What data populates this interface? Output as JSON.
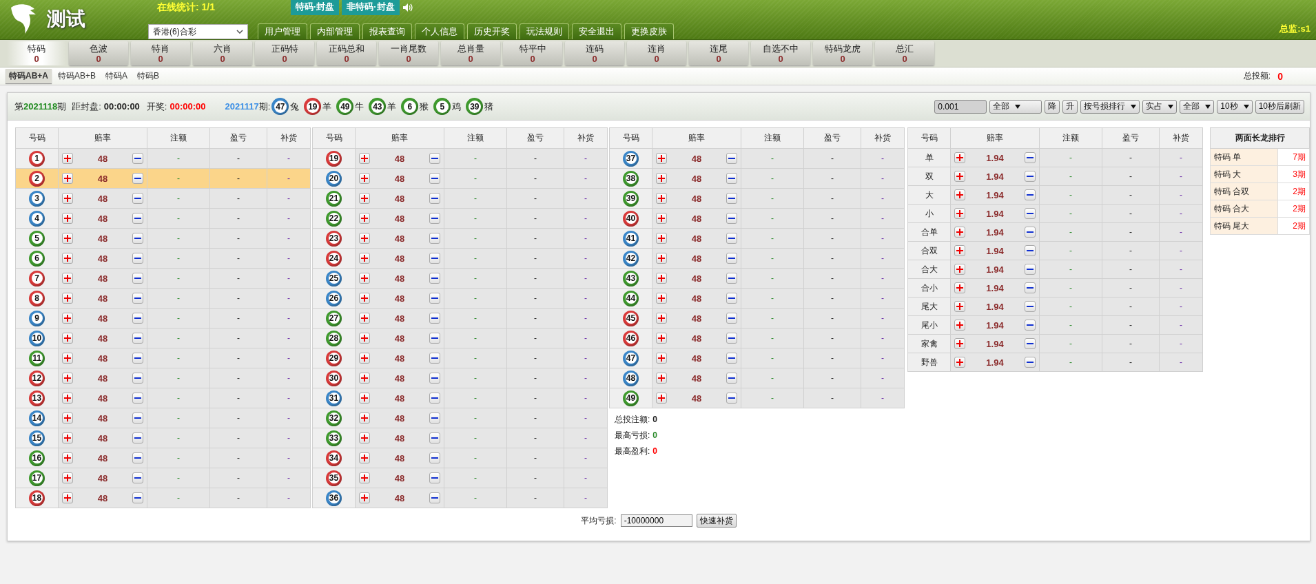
{
  "header": {
    "logo_text": "测试",
    "online": "在线统计: 1/1",
    "status_badges": [
      "特码·封盘",
      "非特码·封盘"
    ],
    "lottery_select": "香港(6)合彩",
    "nav": [
      "用户管理",
      "内部管理",
      "报表查询",
      "个人信息",
      "历史开奖",
      "玩法规则",
      "安全退出",
      "更换皮肤"
    ],
    "user": "总监:s1"
  },
  "category_tabs": [
    {
      "label": "特码",
      "count": "0",
      "selected": true
    },
    {
      "label": "色波",
      "count": "0",
      "selected": false
    },
    {
      "label": "特肖",
      "count": "0",
      "selected": false
    },
    {
      "label": "六肖",
      "count": "0",
      "selected": false
    },
    {
      "label": "正码特",
      "count": "0",
      "selected": false
    },
    {
      "label": "正码总和",
      "count": "0",
      "selected": false
    },
    {
      "label": "一肖尾数",
      "count": "0",
      "selected": false
    },
    {
      "label": "总肖量",
      "count": "0",
      "selected": false
    },
    {
      "label": "特平中",
      "count": "0",
      "selected": false
    },
    {
      "label": "连码",
      "count": "0",
      "selected": false
    },
    {
      "label": "连肖",
      "count": "0",
      "selected": false
    },
    {
      "label": "连尾",
      "count": "0",
      "selected": false
    },
    {
      "label": "自选不中",
      "count": "0",
      "selected": false
    },
    {
      "label": "特码龙虎",
      "count": "0",
      "selected": false
    },
    {
      "label": "总汇",
      "count": "0",
      "selected": false
    }
  ],
  "sub_tabs": [
    {
      "label": "特码AB+A",
      "selected": true
    },
    {
      "label": "特码AB+B",
      "selected": false
    },
    {
      "label": "特码A",
      "selected": false
    },
    {
      "label": "特码B",
      "selected": false
    }
  ],
  "total_bet": {
    "label": "总投额:",
    "value": "0"
  },
  "draw_info": {
    "prefix": "第",
    "period": "2021118",
    "suffix": "期",
    "close_label": "距封盘:",
    "close_time": "00:00:00",
    "draw_label": "开奖:",
    "draw_time": "00:00:00",
    "last_period": "2021117",
    "last_suffix": "期:",
    "last_result": [
      {
        "number": "47",
        "color": "#3a86c8",
        "zodiac": "兔"
      },
      {
        "number": "19",
        "color": "#d83a3a",
        "zodiac": "羊"
      },
      {
        "number": "49",
        "color": "#3f9a2e",
        "zodiac": "牛"
      },
      {
        "number": "43",
        "color": "#3f9a2e",
        "zodiac": "羊"
      },
      {
        "number": "6",
        "color": "#3f9a2e",
        "zodiac": "猴"
      },
      {
        "number": "5",
        "color": "#3f9a2e",
        "zodiac": "鸡"
      },
      {
        "number": "39",
        "color": "#3f9a2e",
        "zodiac": "猪"
      }
    ]
  },
  "controls": [
    {
      "kind": "input",
      "value": "0.001"
    },
    {
      "kind": "select",
      "label": "全部"
    },
    {
      "kind": "button",
      "label": "降"
    },
    {
      "kind": "button",
      "label": "升"
    },
    {
      "kind": "select",
      "label": "按号损排行"
    },
    {
      "kind": "select",
      "label": "实占"
    },
    {
      "kind": "select",
      "label": "全部"
    },
    {
      "kind": "select",
      "label": "10秒"
    },
    {
      "kind": "button",
      "label": "10秒后刷新"
    }
  ],
  "number_tables": [
    {
      "columns": [
        "号码",
        "赔率",
        "注额",
        "盈亏",
        "补货"
      ],
      "rows": [
        {
          "number": "1",
          "color": "#d83a3a",
          "odds": "48",
          "bet": "-",
          "profit": "-",
          "cover": "-",
          "selected": false
        },
        {
          "number": "2",
          "color": "#d83a3a",
          "odds": "48",
          "bet": "-",
          "profit": "-",
          "cover": "-",
          "selected": true
        },
        {
          "number": "3",
          "color": "#3a86c8",
          "odds": "48",
          "bet": "-",
          "profit": "-",
          "cover": "-",
          "selected": false
        },
        {
          "number": "4",
          "color": "#3a86c8",
          "odds": "48",
          "bet": "-",
          "profit": "-",
          "cover": "-",
          "selected": false
        },
        {
          "number": "5",
          "color": "#3f9a2e",
          "odds": "48",
          "bet": "-",
          "profit": "-",
          "cover": "-",
          "selected": false
        },
        {
          "number": "6",
          "color": "#3f9a2e",
          "odds": "48",
          "bet": "-",
          "profit": "-",
          "cover": "-",
          "selected": false
        },
        {
          "number": "7",
          "color": "#d83a3a",
          "odds": "48",
          "bet": "-",
          "profit": "-",
          "cover": "-",
          "selected": false
        },
        {
          "number": "8",
          "color": "#d83a3a",
          "odds": "48",
          "bet": "-",
          "profit": "-",
          "cover": "-",
          "selected": false
        },
        {
          "number": "9",
          "color": "#3a86c8",
          "odds": "48",
          "bet": "-",
          "profit": "-",
          "cover": "-",
          "selected": false
        },
        {
          "number": "10",
          "color": "#3a86c8",
          "odds": "48",
          "bet": "-",
          "profit": "-",
          "cover": "-",
          "selected": false
        },
        {
          "number": "11",
          "color": "#3f9a2e",
          "odds": "48",
          "bet": "-",
          "profit": "-",
          "cover": "-",
          "selected": false
        },
        {
          "number": "12",
          "color": "#d83a3a",
          "odds": "48",
          "bet": "-",
          "profit": "-",
          "cover": "-",
          "selected": false
        },
        {
          "number": "13",
          "color": "#d83a3a",
          "odds": "48",
          "bet": "-",
          "profit": "-",
          "cover": "-",
          "selected": false
        },
        {
          "number": "14",
          "color": "#3a86c8",
          "odds": "48",
          "bet": "-",
          "profit": "-",
          "cover": "-",
          "selected": false
        },
        {
          "number": "15",
          "color": "#3a86c8",
          "odds": "48",
          "bet": "-",
          "profit": "-",
          "cover": "-",
          "selected": false
        },
        {
          "number": "16",
          "color": "#3f9a2e",
          "odds": "48",
          "bet": "-",
          "profit": "-",
          "cover": "-",
          "selected": false
        },
        {
          "number": "17",
          "color": "#3f9a2e",
          "odds": "48",
          "bet": "-",
          "profit": "-",
          "cover": "-",
          "selected": false
        },
        {
          "number": "18",
          "color": "#d83a3a",
          "odds": "48",
          "bet": "-",
          "profit": "-",
          "cover": "-",
          "selected": false
        }
      ]
    },
    {
      "columns": [
        "号码",
        "赔率",
        "注额",
        "盈亏",
        "补货"
      ],
      "rows": [
        {
          "number": "19",
          "color": "#d83a3a",
          "odds": "48",
          "bet": "-",
          "profit": "-",
          "cover": "-",
          "selected": false
        },
        {
          "number": "20",
          "color": "#3a86c8",
          "odds": "48",
          "bet": "-",
          "profit": "-",
          "cover": "-",
          "selected": false
        },
        {
          "number": "21",
          "color": "#3f9a2e",
          "odds": "48",
          "bet": "-",
          "profit": "-",
          "cover": "-",
          "selected": false
        },
        {
          "number": "22",
          "color": "#3f9a2e",
          "odds": "48",
          "bet": "-",
          "profit": "-",
          "cover": "-",
          "selected": false
        },
        {
          "number": "23",
          "color": "#d83a3a",
          "odds": "48",
          "bet": "-",
          "profit": "-",
          "cover": "-",
          "selected": false
        },
        {
          "number": "24",
          "color": "#d83a3a",
          "odds": "48",
          "bet": "-",
          "profit": "-",
          "cover": "-",
          "selected": false
        },
        {
          "number": "25",
          "color": "#3a86c8",
          "odds": "48",
          "bet": "-",
          "profit": "-",
          "cover": "-",
          "selected": false
        },
        {
          "number": "26",
          "color": "#3a86c8",
          "odds": "48",
          "bet": "-",
          "profit": "-",
          "cover": "-",
          "selected": false
        },
        {
          "number": "27",
          "color": "#3f9a2e",
          "odds": "48",
          "bet": "-",
          "profit": "-",
          "cover": "-",
          "selected": false
        },
        {
          "number": "28",
          "color": "#3f9a2e",
          "odds": "48",
          "bet": "-",
          "profit": "-",
          "cover": "-",
          "selected": false
        },
        {
          "number": "29",
          "color": "#d83a3a",
          "odds": "48",
          "bet": "-",
          "profit": "-",
          "cover": "-",
          "selected": false
        },
        {
          "number": "30",
          "color": "#d83a3a",
          "odds": "48",
          "bet": "-",
          "profit": "-",
          "cover": "-",
          "selected": false
        },
        {
          "number": "31",
          "color": "#3a86c8",
          "odds": "48",
          "bet": "-",
          "profit": "-",
          "cover": "-",
          "selected": false
        },
        {
          "number": "32",
          "color": "#3f9a2e",
          "odds": "48",
          "bet": "-",
          "profit": "-",
          "cover": "-",
          "selected": false
        },
        {
          "number": "33",
          "color": "#3f9a2e",
          "odds": "48",
          "bet": "-",
          "profit": "-",
          "cover": "-",
          "selected": false
        },
        {
          "number": "34",
          "color": "#d83a3a",
          "odds": "48",
          "bet": "-",
          "profit": "-",
          "cover": "-",
          "selected": false
        },
        {
          "number": "35",
          "color": "#d83a3a",
          "odds": "48",
          "bet": "-",
          "profit": "-",
          "cover": "-",
          "selected": false
        },
        {
          "number": "36",
          "color": "#3a86c8",
          "odds": "48",
          "bet": "-",
          "profit": "-",
          "cover": "-",
          "selected": false
        }
      ]
    },
    {
      "columns": [
        "号码",
        "赔率",
        "注额",
        "盈亏",
        "补货"
      ],
      "rows": [
        {
          "number": "37",
          "color": "#3a86c8",
          "odds": "48",
          "bet": "-",
          "profit": "-",
          "cover": "-",
          "selected": false
        },
        {
          "number": "38",
          "color": "#3f9a2e",
          "odds": "48",
          "bet": "-",
          "profit": "-",
          "cover": "-",
          "selected": false
        },
        {
          "number": "39",
          "color": "#3f9a2e",
          "odds": "48",
          "bet": "-",
          "profit": "-",
          "cover": "-",
          "selected": false
        },
        {
          "number": "40",
          "color": "#d83a3a",
          "odds": "48",
          "bet": "-",
          "profit": "-",
          "cover": "-",
          "selected": false
        },
        {
          "number": "41",
          "color": "#3a86c8",
          "odds": "48",
          "bet": "-",
          "profit": "-",
          "cover": "-",
          "selected": false
        },
        {
          "number": "42",
          "color": "#3a86c8",
          "odds": "48",
          "bet": "-",
          "profit": "-",
          "cover": "-",
          "selected": false
        },
        {
          "number": "43",
          "color": "#3f9a2e",
          "odds": "48",
          "bet": "-",
          "profit": "-",
          "cover": "-",
          "selected": false
        },
        {
          "number": "44",
          "color": "#3f9a2e",
          "odds": "48",
          "bet": "-",
          "profit": "-",
          "cover": "-",
          "selected": false
        },
        {
          "number": "45",
          "color": "#d83a3a",
          "odds": "48",
          "bet": "-",
          "profit": "-",
          "cover": "-",
          "selected": false
        },
        {
          "number": "46",
          "color": "#d83a3a",
          "odds": "48",
          "bet": "-",
          "profit": "-",
          "cover": "-",
          "selected": false
        },
        {
          "number": "47",
          "color": "#3a86c8",
          "odds": "48",
          "bet": "-",
          "profit": "-",
          "cover": "-",
          "selected": false
        },
        {
          "number": "48",
          "color": "#3a86c8",
          "odds": "48",
          "bet": "-",
          "profit": "-",
          "cover": "-",
          "selected": false
        },
        {
          "number": "49",
          "color": "#3f9a2e",
          "odds": "48",
          "bet": "-",
          "profit": "-",
          "cover": "-",
          "selected": false
        }
      ]
    }
  ],
  "summary": [
    {
      "kind": "total",
      "label": "总投注额:",
      "value": "0"
    },
    {
      "kind": "loss",
      "label": "最高亏损:",
      "value": "0"
    },
    {
      "kind": "profit",
      "label": "最高盈利:",
      "value": "0"
    }
  ],
  "attribute_table": {
    "columns": [
      "号码",
      "赔率",
      "注额",
      "盈亏",
      "补货"
    ],
    "rows": [
      {
        "name": "单",
        "odds": "1.94",
        "bet": "-",
        "profit": "-",
        "cover": "-"
      },
      {
        "name": "双",
        "odds": "1.94",
        "bet": "-",
        "profit": "-",
        "cover": "-"
      },
      {
        "name": "大",
        "odds": "1.94",
        "bet": "-",
        "profit": "-",
        "cover": "-"
      },
      {
        "name": "小",
        "odds": "1.94",
        "bet": "-",
        "profit": "-",
        "cover": "-"
      },
      {
        "name": "合单",
        "odds": "1.94",
        "bet": "-",
        "profit": "-",
        "cover": "-"
      },
      {
        "name": "合双",
        "odds": "1.94",
        "bet": "-",
        "profit": "-",
        "cover": "-"
      },
      {
        "name": "合大",
        "odds": "1.94",
        "bet": "-",
        "profit": "-",
        "cover": "-"
      },
      {
        "name": "合小",
        "odds": "1.94",
        "bet": "-",
        "profit": "-",
        "cover": "-"
      },
      {
        "name": "尾大",
        "odds": "1.94",
        "bet": "-",
        "profit": "-",
        "cover": "-"
      },
      {
        "name": "尾小",
        "odds": "1.94",
        "bet": "-",
        "profit": "-",
        "cover": "-"
      },
      {
        "name": "家禽",
        "odds": "1.94",
        "bet": "-",
        "profit": "-",
        "cover": "-"
      },
      {
        "name": "野兽",
        "odds": "1.94",
        "bet": "-",
        "profit": "-",
        "cover": "-"
      }
    ]
  },
  "streak_ranking": {
    "title": "两面长龙排行",
    "rows": [
      {
        "name": "特码 单",
        "periods": "7期"
      },
      {
        "name": "特码 大",
        "periods": "3期"
      },
      {
        "name": "特码 合双",
        "periods": "2期"
      },
      {
        "name": "特码 合大",
        "periods": "2期"
      },
      {
        "name": "特码 尾大",
        "periods": "2期"
      }
    ]
  },
  "footer": {
    "label": "平均亏损:",
    "value": "-10000000",
    "button": "快速补货"
  }
}
